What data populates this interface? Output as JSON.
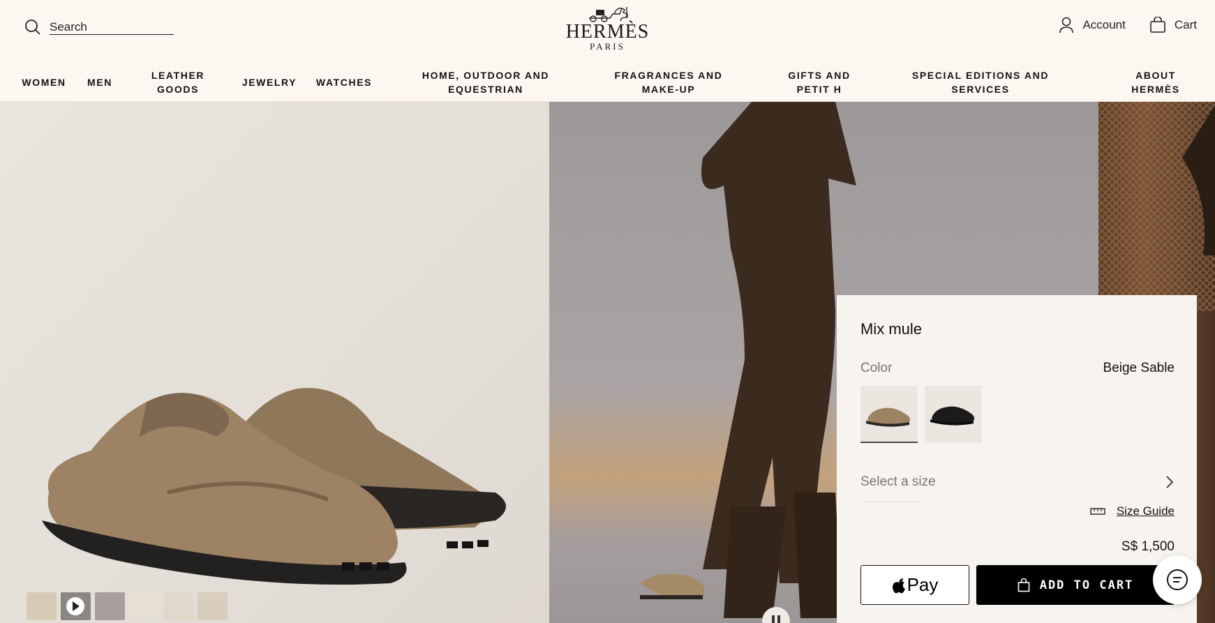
{
  "header": {
    "search_label": "Search",
    "brand": "HERMÈS",
    "brand_sub": "PARIS",
    "account_label": "Account",
    "cart_label": "Cart"
  },
  "nav": {
    "items": [
      {
        "label": "WOMEN"
      },
      {
        "label": "MEN"
      },
      {
        "label": "LEATHER GOODS"
      },
      {
        "label": "JEWELRY"
      },
      {
        "label": "WATCHES"
      },
      {
        "label": "HOME, OUTDOOR AND EQUESTRIAN"
      },
      {
        "label": "FRAGRANCES AND MAKE-UP"
      },
      {
        "label": "GIFTS AND PETIT H"
      },
      {
        "label": "SPECIAL EDITIONS AND SERVICES"
      },
      {
        "label": "ABOUT HERMÈS"
      }
    ]
  },
  "gallery": {
    "thumbnails": [
      "shoe-side",
      "video",
      "worn",
      "shoe-top",
      "pair",
      "sole"
    ]
  },
  "product": {
    "name": "Mix mule",
    "color_label": "Color",
    "color_value": "Beige Sable",
    "size_placeholder": "Select a size",
    "size_guide_label": "Size Guide",
    "price": "S$ 1,500",
    "pay_label": "Pay",
    "add_to_cart_label": "ADD TO CART"
  },
  "colors": {
    "accent": "#000000",
    "background": "#fcf7f1",
    "suede": "#9d8263"
  }
}
